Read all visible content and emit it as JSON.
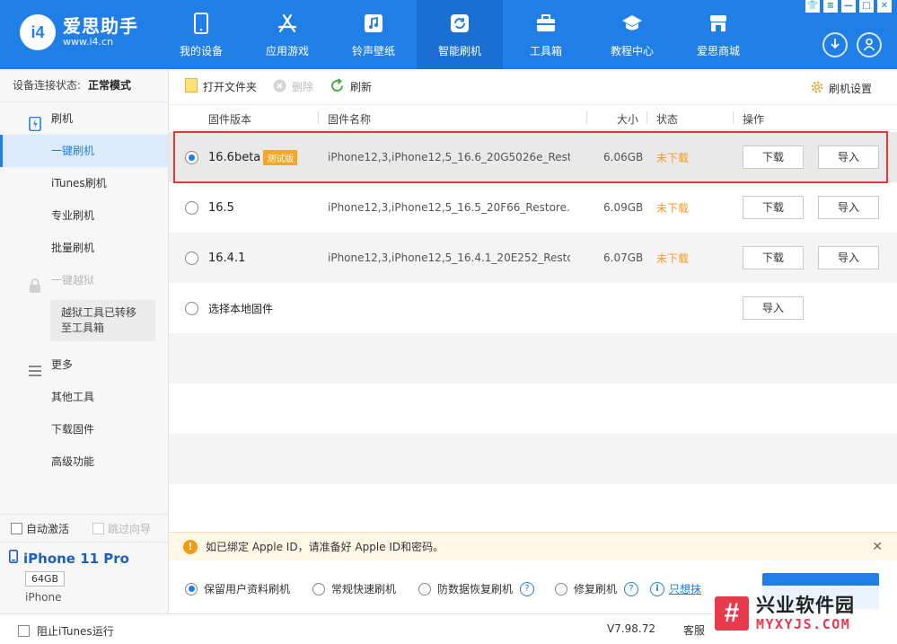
{
  "app": {
    "logo_mark": "i4",
    "logo_title": "爱思助手",
    "logo_url": "www.i4.cn"
  },
  "nav": [
    {
      "label": "我的设备",
      "icon": "phone-icon"
    },
    {
      "label": "应用游戏",
      "icon": "app-store-icon"
    },
    {
      "label": "铃声壁纸",
      "icon": "music-icon"
    },
    {
      "label": "智能刷机",
      "icon": "refresh-icon",
      "active": true
    },
    {
      "label": "工具箱",
      "icon": "toolbox-icon"
    },
    {
      "label": "教程中心",
      "icon": "graduation-cap-icon"
    },
    {
      "label": "爱思商城",
      "icon": "shop-icon"
    }
  ],
  "window_controls": [
    "👕",
    "≡",
    "—",
    "□",
    "✕"
  ],
  "sidebar": {
    "conn_label": "设备连接状态:",
    "conn_value": "正常模式",
    "items": [
      {
        "label": "刷机",
        "type": "head"
      },
      {
        "label": "一键刷机",
        "active": true
      },
      {
        "label": "iTunes刷机"
      },
      {
        "label": "专业刷机"
      },
      {
        "label": "批量刷机"
      },
      {
        "label": "一键越狱",
        "type": "head",
        "disabled": true
      },
      {
        "label": "更多",
        "type": "head"
      },
      {
        "label": "其他工具"
      },
      {
        "label": "下载固件"
      },
      {
        "label": "高级功能"
      }
    ],
    "jailbreak_note": "越狱工具已转移至工具箱",
    "auto_activate": "自动激活",
    "skip_guide": "跳过向导",
    "device_name": "iPhone 11 Pro",
    "device_capacity": "64GB",
    "device_type": "iPhone"
  },
  "toolbar": {
    "open_folder": "打开文件夹",
    "delete": "删除",
    "refresh": "刷新",
    "settings": "刷机设置"
  },
  "table": {
    "headers": {
      "version": "固件版本",
      "name": "固件名称",
      "size": "大小",
      "status": "状态",
      "action": "操作"
    },
    "rows": [
      {
        "version": "16.6beta",
        "tag": "测试版",
        "name": "iPhone12,3,iPhone12,5_16.6_20G5026e_Rest...",
        "size": "6.06GB",
        "status": "未下载",
        "download": "下载",
        "import": "导入",
        "selected": true
      },
      {
        "version": "16.5",
        "name": "iPhone12,3,iPhone12,5_16.5_20F66_Restore.i...",
        "size": "6.09GB",
        "status": "未下载",
        "download": "下载",
        "import": "导入"
      },
      {
        "version": "16.4.1",
        "name": "iPhone12,3,iPhone12,5_16.4.1_20E252_Resto...",
        "size": "6.07GB",
        "status": "未下载",
        "download": "下载",
        "import": "导入"
      }
    ],
    "local_label": "选择本地固件",
    "local_import": "导入"
  },
  "notice": {
    "icon": "!",
    "text": "如已绑定 Apple ID，请准备好 Apple ID和密码。"
  },
  "modes": [
    {
      "label": "保留用户资料刷机",
      "checked": true
    },
    {
      "label": "常规快速刷机"
    },
    {
      "label": "防数据恢复刷机",
      "help": "?"
    },
    {
      "label": "修复刷机",
      "help": "?"
    }
  ],
  "info_link": "只想抹",
  "status": {
    "block_itunes": "阻止iTunes运行",
    "version": "V7.98.72",
    "service": "客服"
  },
  "watermark": {
    "logo": "#",
    "cn": "兴业软件园",
    "url": "MYXYJS.COM"
  }
}
